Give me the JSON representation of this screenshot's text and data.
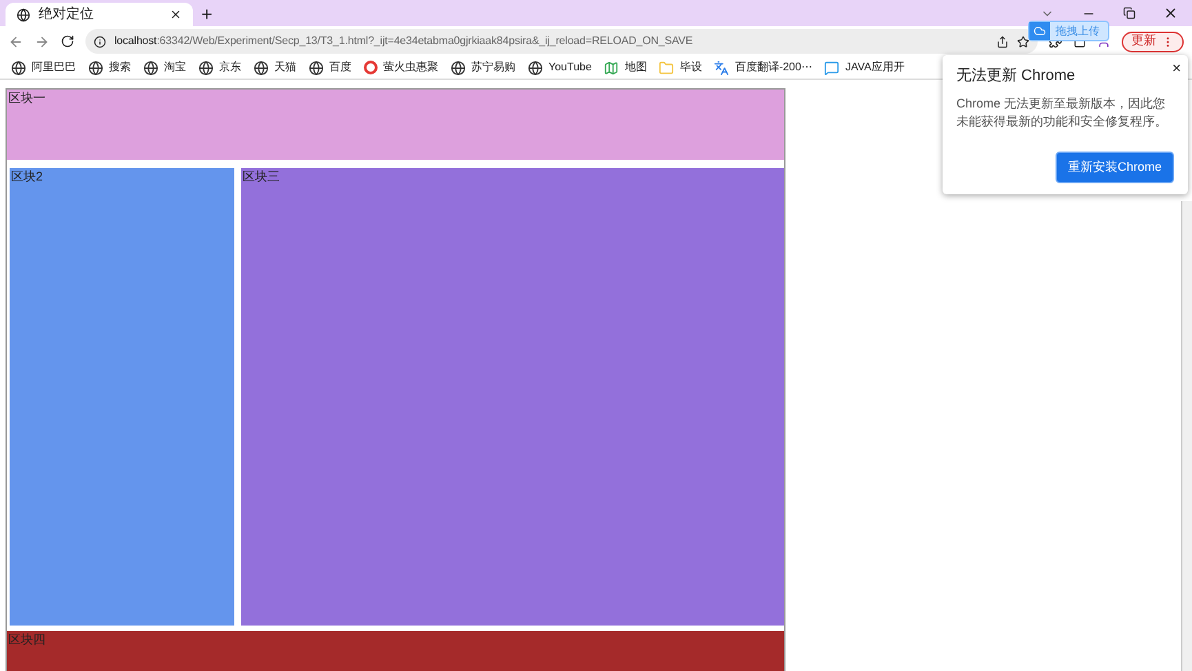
{
  "tabs": [
    {
      "title": "绝对定位",
      "selected": true
    }
  ],
  "new_tab": "+",
  "address": {
    "host": "localhost",
    "rest": ":63342/Web/Experiment/Secp_13/T3_1.html?_ijt=4e34etabma0gjrkiaak84psira&_ij_reload=RELOAD_ON_SAVE"
  },
  "update_button": "更新",
  "upload_badge": "拖拽上传",
  "bookmarks": [
    {
      "label": "阿里巴巴",
      "kind": "globe"
    },
    {
      "label": "搜索",
      "kind": "globe"
    },
    {
      "label": "淘宝",
      "kind": "globe"
    },
    {
      "label": "京东",
      "kind": "globe"
    },
    {
      "label": "天猫",
      "kind": "globe"
    },
    {
      "label": "百度",
      "kind": "globe"
    },
    {
      "label": "萤火虫惠聚",
      "kind": "ring"
    },
    {
      "label": "苏宁易购",
      "kind": "globe"
    },
    {
      "label": "YouTube",
      "kind": "globe"
    },
    {
      "label": "地图",
      "kind": "map"
    },
    {
      "label": "毕设",
      "kind": "folder"
    },
    {
      "label": "百度翻译-200⋯",
      "kind": "translate"
    },
    {
      "label": "JAVA应用开",
      "kind": "chat"
    }
  ],
  "blocks": [
    {
      "label": "区块一",
      "color": "#dda0dd"
    },
    {
      "label": "区块2",
      "color": "#6495ed"
    },
    {
      "label": "区块三",
      "color": "#9370db"
    },
    {
      "label": "区块四",
      "color": "#a52a2a"
    }
  ],
  "popup": {
    "title": "无法更新 Chrome",
    "body": "Chrome 无法更新至最新版本，因此您未能获得最新的功能和安全修复程序。",
    "button": "重新安装Chrome",
    "close": "×"
  }
}
